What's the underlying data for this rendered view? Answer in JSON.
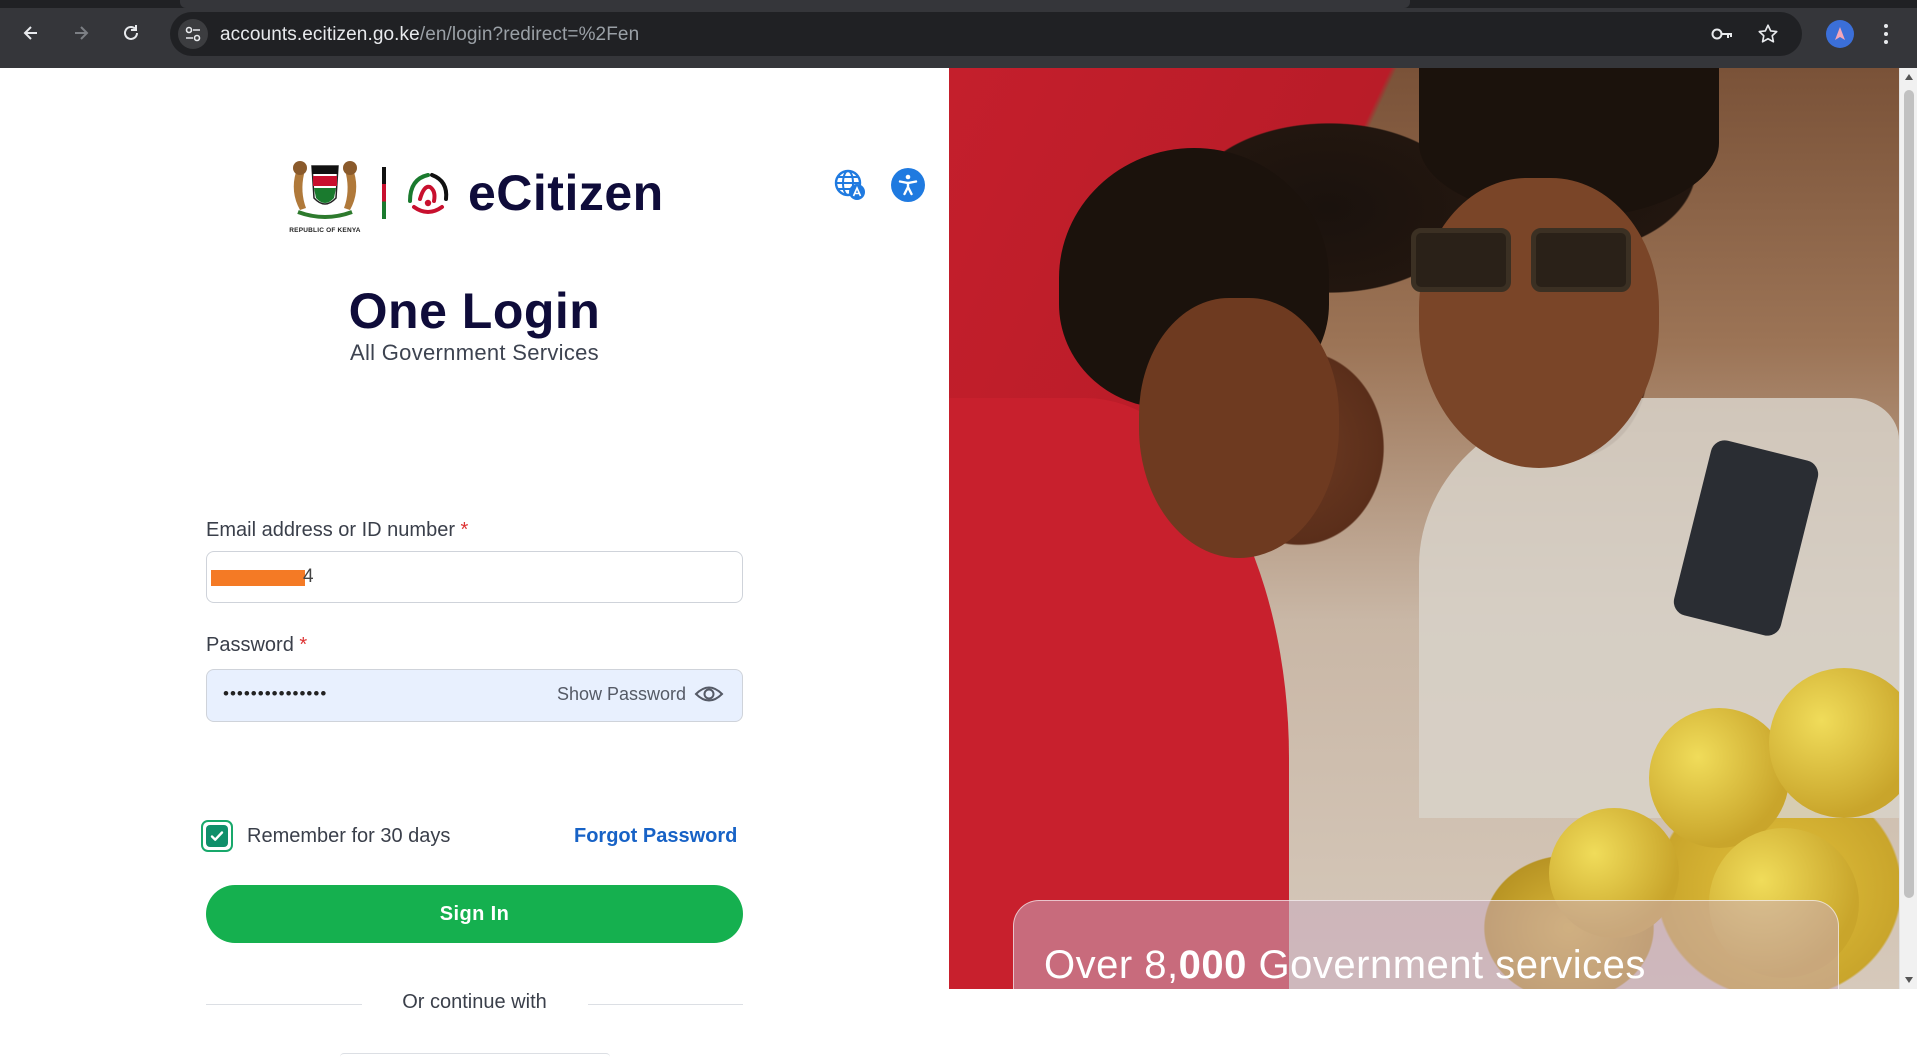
{
  "browser": {
    "url_host": "accounts.ecitizen.go.ke",
    "url_path": "/en/login?redirect=%2Fen",
    "icons": [
      "back-icon",
      "forward-icon",
      "reload-icon",
      "site-info-icon",
      "password-key-icon",
      "bookmark-star-icon",
      "profile-icon",
      "menu-icon"
    ],
    "colors": {
      "frame": "#35363a",
      "omnibox": "#202124",
      "text": "#e8eaed"
    }
  },
  "header": {
    "coat_caption": "REPUBLIC OF KENYA",
    "brand": "eCitizen",
    "icons": [
      "coat-of-arms-icon",
      "ecitizen-logo-icon",
      "language-icon",
      "accessibility-icon"
    ]
  },
  "hero": {
    "title": "One Login",
    "subtitle": "All Government Services"
  },
  "form": {
    "email_label": "Email address or ID number",
    "required_mark": "*",
    "email_value_visible": "4",
    "password_label": "Password",
    "password_value": "•••••••••••••••",
    "show_password": "Show Password",
    "remember_label": "Remember for 30 days",
    "remember_checked": true,
    "forgot_password": "Forgot Password",
    "sign_in": "Sign In",
    "or_continue": "Or continue with"
  },
  "promo": {
    "banner_prefix": "Over 8,",
    "banner_bold": "000",
    "banner_suffix": " Government services"
  },
  "colors": {
    "primary_green": "#15b04f",
    "link_blue": "#1762c6",
    "navy": "#0f0c3a",
    "accessibility_blue": "#1f7ae0",
    "checkbox_green": "#0f8f6a",
    "required_red": "#dd3333"
  }
}
